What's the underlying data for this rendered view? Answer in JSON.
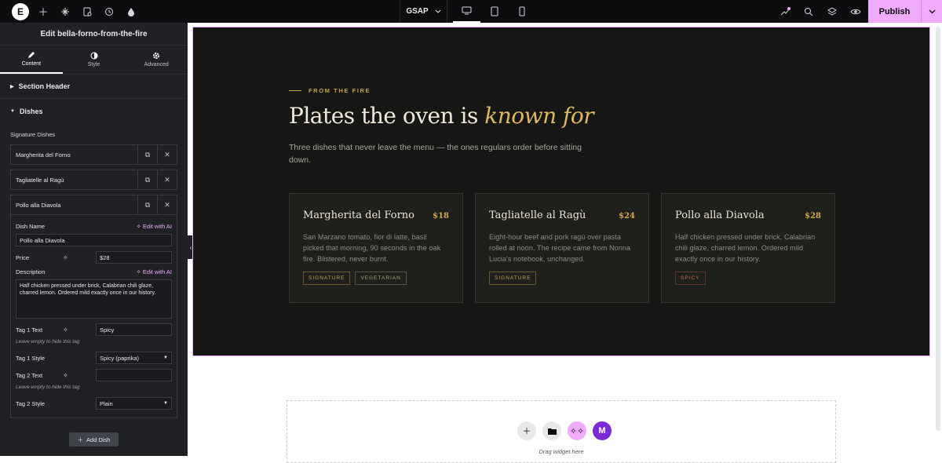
{
  "topbar": {
    "gsap_label": "GSAP",
    "publish_label": "Publish"
  },
  "panel": {
    "title": "Edit bella-forno-from-the-fire",
    "tabs": [
      {
        "label": "Content",
        "icon": "pencil-icon"
      },
      {
        "label": "Style",
        "icon": "contrast-icon"
      },
      {
        "label": "Advanced",
        "icon": "gear-icon"
      }
    ],
    "sections": {
      "section_header": "Section Header",
      "dishes": "Dishes"
    },
    "signature_label": "Signature Dishes",
    "items": [
      {
        "name": "Margherita del Forno"
      },
      {
        "name": "Tagliatelle al Ragù"
      },
      {
        "name": "Pollo alla Diavola"
      }
    ],
    "form": {
      "dish_name_label": "Dish Name",
      "edit_ai": "Edit with AI",
      "dish_name_value": "Pollo alla Diavola",
      "price_label": "Price",
      "price_value": "$28",
      "description_label": "Description",
      "description_value": "Half chicken pressed under brick, Calabrian chili glaze, charred lemon. Ordered mild exactly once in our history.",
      "tag1_text_label": "Tag 1 Text",
      "tag1_text_value": "Spicy",
      "hint": "Leave empty to hide this tag",
      "tag1_style_label": "Tag 1 Style",
      "tag1_style_value": "Spicy (paprika)",
      "tag2_text_label": "Tag 2 Text",
      "tag2_text_value": "",
      "tag2_style_label": "Tag 2 Style",
      "tag2_style_value": "Plain"
    },
    "add_dish": "Add Dish"
  },
  "section": {
    "eyebrow": "FROM THE FIRE",
    "headline_start": "Plates the oven is ",
    "headline_em": "known for",
    "lede": "Three dishes that never leave the menu — the ones regulars order before sitting down.",
    "cards": [
      {
        "name": "Margherita del Forno",
        "price": "$18",
        "desc": "San Marzano tomato, fior di latte, basil picked that morning, 90 seconds in the oak fire. Blistered, never burnt.",
        "tags": [
          "SIGNATURE",
          "VEGETARIAN"
        ]
      },
      {
        "name": "Tagliatelle al Ragù",
        "price": "$24",
        "desc": "Eight-hour beef and pork ragù over pasta rolled at noon. The recipe came from Nonna Lucia's notebook, unchanged.",
        "tags": [
          "SIGNATURE"
        ]
      },
      {
        "name": "Pollo alla Diavola",
        "price": "$28",
        "desc": "Half chicken pressed under brick, Calabrian chili glaze, charred lemon. Ordered mild exactly once in our history.",
        "tags": [
          "SPICY"
        ]
      }
    ]
  },
  "dropzone": {
    "text": "Drag widget here"
  },
  "colors": {
    "accent": "#f0abfc",
    "gold": "#c8a24f",
    "section_bg": "#161714"
  }
}
